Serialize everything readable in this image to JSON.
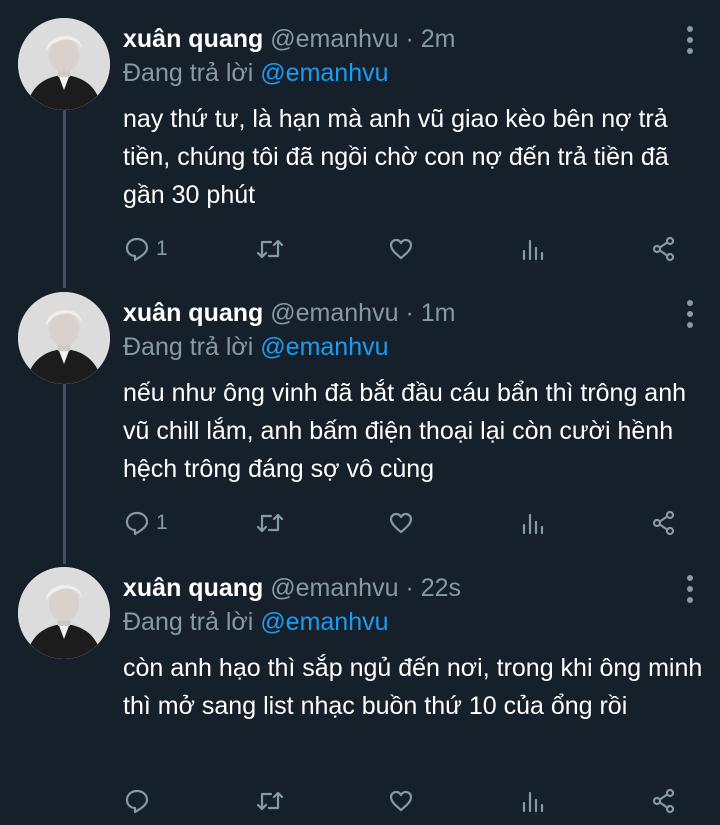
{
  "tweets": [
    {
      "name": "xuân quang",
      "handle": "@emanhvu",
      "time": "2m",
      "reply_prefix": "Đang trả lời",
      "reply_to": "@emanhvu",
      "text": "nay thứ tư, là hạn mà anh vũ giao kèo bên nợ trả tiền, chúng tôi đã ngồi chờ con nợ đến trả tiền đã gần 30 phút",
      "reply_count": "1"
    },
    {
      "name": "xuân quang",
      "handle": "@emanhvu",
      "time": "1m",
      "reply_prefix": "Đang trả lời",
      "reply_to": "@emanhvu",
      "text": "nếu như ông vinh đã bắt đầu cáu bẩn thì trông anh vũ chill lắm, anh bấm điện thoại lại còn cười hềnh hệch trông đáng sợ vô cùng",
      "reply_count": "1"
    },
    {
      "name": "xuân quang",
      "handle": "@emanhvu",
      "time": "22s",
      "reply_prefix": "Đang trả lời",
      "reply_to": "@emanhvu",
      "text": "còn anh hạo thì sắp ngủ đến nơi, trong khi ông minh thì mở sang list nhạc buồn thứ 10 của ổng rồi",
      "reply_count": ""
    }
  ],
  "icons": {
    "reply": "reply-icon",
    "retweet": "retweet-icon",
    "like": "heart-icon",
    "analytics": "analytics-icon",
    "share": "share-icon",
    "more": "more-vertical-icon"
  },
  "colors": {
    "background": "#15202b",
    "secondary_text": "#8899a6",
    "link": "#1d9bf0",
    "thread_line": "#3d5466"
  }
}
